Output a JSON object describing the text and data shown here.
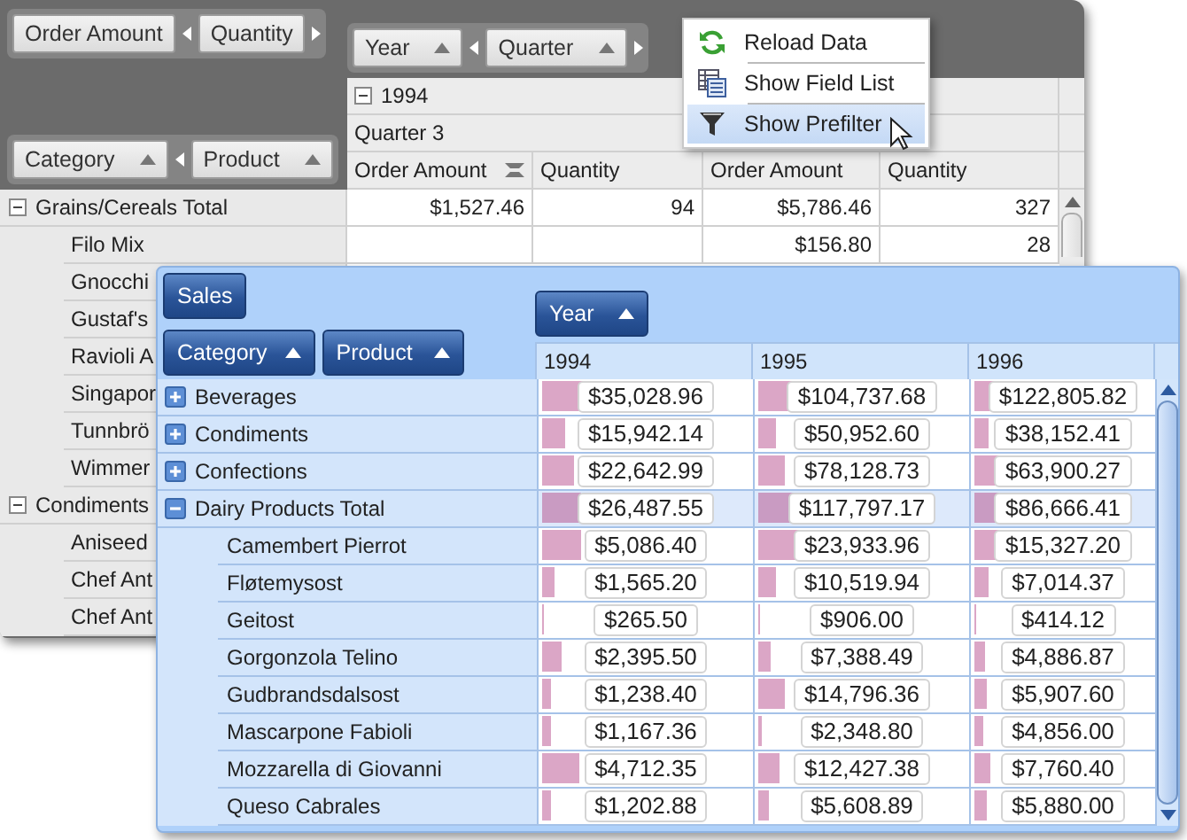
{
  "back_pivot": {
    "data_fields": [
      {
        "label": "Order Amount"
      },
      {
        "label": "Quantity"
      }
    ],
    "data_end_arrow": true,
    "column_fields": [
      {
        "label": "Year",
        "sorted": true
      },
      {
        "label": "Quarter",
        "sorted": true
      }
    ],
    "column_end_arrow": true,
    "row_fields": [
      {
        "label": "Category",
        "sorted": true
      },
      {
        "label": "Product",
        "sorted": true
      }
    ],
    "row_end_arrow": false,
    "column_header": {
      "year": "1994",
      "year_expanded": true,
      "quarter": "Quarter 3",
      "measures": [
        {
          "label": "Order Amount",
          "sorted": true
        },
        {
          "label": "Quantity",
          "sorted": false
        },
        {
          "label": "Order Amount",
          "sorted": false
        },
        {
          "label": "Quantity",
          "sorted": false
        }
      ]
    },
    "rows": [
      {
        "label": "Grains/Cereals Total",
        "expanded": true,
        "values": [
          "$1,527.46",
          "94",
          "$5,786.46",
          "327"
        ],
        "children": [
          {
            "label": "Filo Mix",
            "values": [
              "$156.80",
              "28"
            ]
          },
          {
            "label": "Gnocchi"
          },
          {
            "label": "Gustaf's"
          },
          {
            "label": "Ravioli A"
          },
          {
            "label": "Singapor"
          },
          {
            "label": "Tunnbrö"
          },
          {
            "label": "Wimmer"
          }
        ]
      },
      {
        "label": "Condiments",
        "expanded": true,
        "children": [
          {
            "label": "Aniseed"
          },
          {
            "label": "Chef Ant"
          },
          {
            "label": "Chef Ant"
          }
        ]
      }
    ]
  },
  "context_menu": {
    "items": [
      {
        "label": "Reload Data",
        "selected": false
      },
      {
        "label": "Show Field List",
        "selected": false
      },
      {
        "label": "Show Prefilter",
        "selected": true
      }
    ]
  },
  "front_pivot": {
    "data_fields": [
      {
        "label": "Sales"
      }
    ],
    "row_fields": [
      {
        "label": "Category",
        "sorted": true
      },
      {
        "label": "Product",
        "sorted": true
      }
    ],
    "column_fields": [
      {
        "label": "Year",
        "sorted": true
      }
    ],
    "columns": [
      "1994",
      "1995",
      "1996"
    ],
    "rows": [
      {
        "label": "Beverages",
        "expanded": false,
        "selected": false,
        "cells": [
          {
            "value": "$35,028.96",
            "level": 0.22
          },
          {
            "value": "$104,737.68",
            "level": 0.16
          },
          {
            "value": "$122,805.82",
            "level": 0.26
          }
        ]
      },
      {
        "label": "Condiments",
        "expanded": false,
        "selected": false,
        "cells": [
          {
            "value": "$15,942.14",
            "level": 0.11
          },
          {
            "value": "$50,952.60",
            "level": 0.08
          },
          {
            "value": "$38,152.41",
            "level": 0.08
          }
        ]
      },
      {
        "label": "Confections",
        "expanded": false,
        "selected": false,
        "cells": [
          {
            "value": "$22,642.99",
            "level": 0.15
          },
          {
            "value": "$78,128.73",
            "level": 0.12
          },
          {
            "value": "$63,900.27",
            "level": 0.14
          }
        ]
      },
      {
        "label": "Dairy Products Total",
        "expanded": true,
        "selected": true,
        "cells": [
          {
            "value": "$26,487.55",
            "level": 0.18
          },
          {
            "value": "$117,797.17",
            "level": 0.18
          },
          {
            "value": "$86,666.41",
            "level": 0.19
          }
        ],
        "children": [
          {
            "label": "Camembert Pierrot",
            "selected": false,
            "cells": [
              {
                "value": "$5,086.40",
                "level": 0.18
              },
              {
                "value": "$23,933.96",
                "level": 0.19
              },
              {
                "value": "$15,327.20",
                "level": 0.2
              }
            ]
          },
          {
            "label": "Fløtemysost",
            "selected": false,
            "cells": [
              {
                "value": "$1,565.20",
                "level": 0.06
              },
              {
                "value": "$10,519.94",
                "level": 0.08
              },
              {
                "value": "$7,014.37",
                "level": 0.08
              }
            ]
          },
          {
            "label": "Geitost",
            "selected": false,
            "cells": [
              {
                "value": "$265.50",
                "level": 0.01
              },
              {
                "value": "$906.00",
                "level": 0.01
              },
              {
                "value": "$414.12",
                "level": 0.01
              }
            ]
          },
          {
            "label": "Gorgonzola Telino",
            "selected": false,
            "cells": [
              {
                "value": "$2,395.50",
                "level": 0.09
              },
              {
                "value": "$7,388.49",
                "level": 0.06
              },
              {
                "value": "$4,886.87",
                "level": 0.06
              }
            ]
          },
          {
            "label": "Gudbrandsdalsost",
            "selected": false,
            "cells": [
              {
                "value": "$1,238.40",
                "level": 0.04
              },
              {
                "value": "$14,796.36",
                "level": 0.12
              },
              {
                "value": "$5,907.60",
                "level": 0.07
              }
            ]
          },
          {
            "label": "Mascarpone Fabioli",
            "selected": false,
            "cells": [
              {
                "value": "$1,167.36",
                "level": 0.04
              },
              {
                "value": "$2,348.80",
                "level": 0.02
              },
              {
                "value": "$4,856.00",
                "level": 0.05
              }
            ]
          },
          {
            "label": "Mozzarella di Giovanni",
            "selected": false,
            "cells": [
              {
                "value": "$4,712.35",
                "level": 0.17
              },
              {
                "value": "$12,427.38",
                "level": 0.1
              },
              {
                "value": "$7,760.40",
                "level": 0.09
              }
            ]
          },
          {
            "label": "Queso Cabrales",
            "selected": false,
            "cells": [
              {
                "value": "$1,202.88",
                "level": 0.04
              },
              {
                "value": "$5,608.89",
                "level": 0.05
              },
              {
                "value": "$5,880.00",
                "level": 0.07
              }
            ]
          }
        ]
      }
    ]
  }
}
